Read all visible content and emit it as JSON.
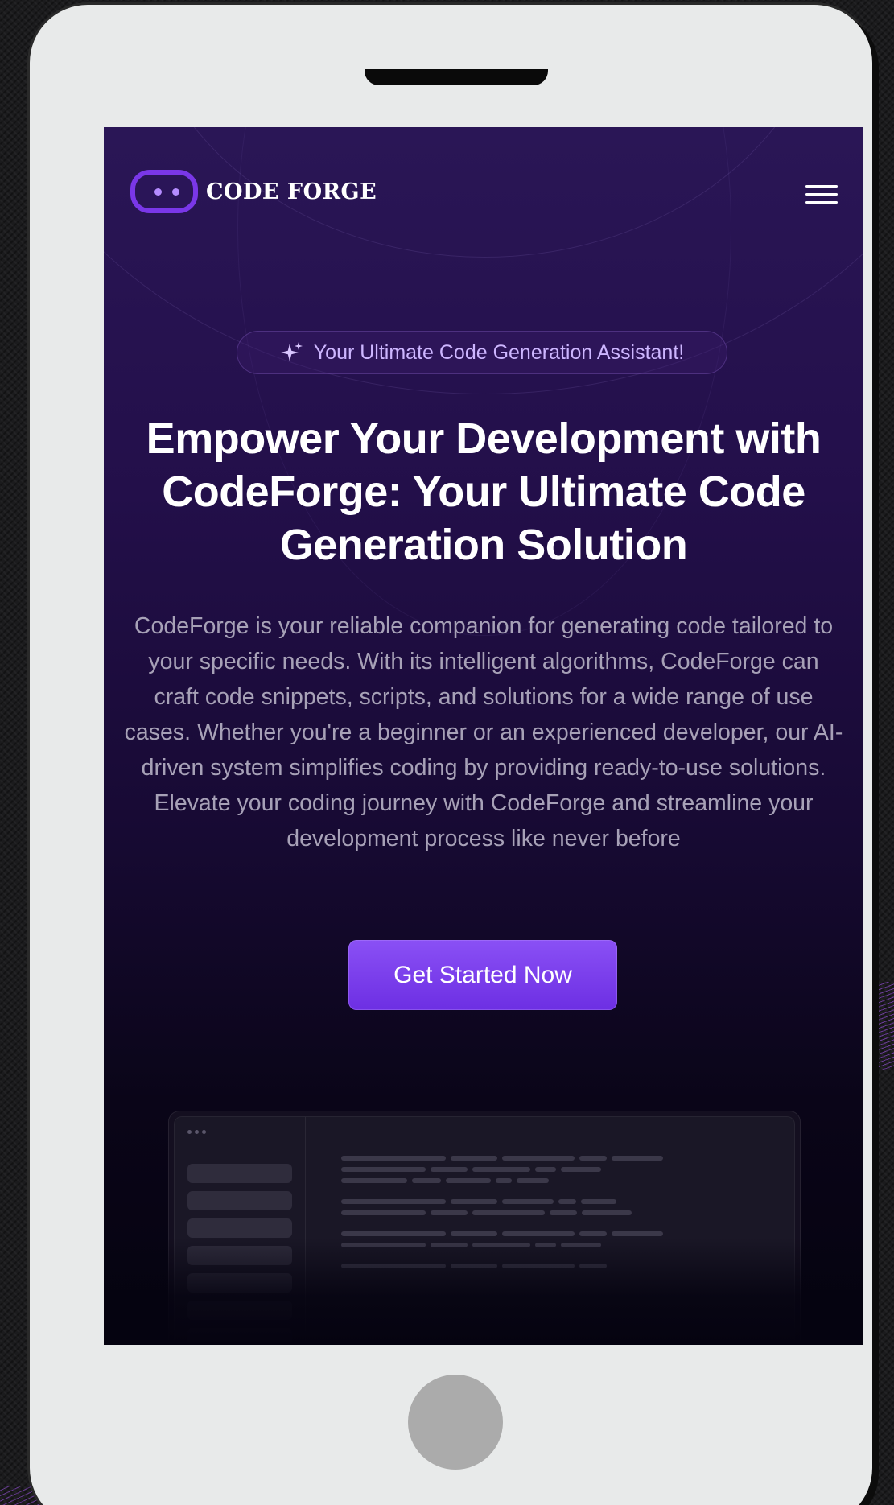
{
  "app": {
    "logo_text": "CODE FORGE",
    "logo_icon": "robot-face-icon",
    "menu_icon": "hamburger-menu-icon"
  },
  "hero": {
    "badge_icon": "sparkle-icon",
    "badge_text": "Your Ultimate Code Generation Assistant!",
    "title": "Empower Your Development with CodeForge: Your Ultimate Code Generation Solution",
    "description": "CodeForge is your reliable companion for generating code tailored to your specific needs. With its intelligent algorithms, CodeForge can craft code snippets, scripts, and solutions for a wide range of use cases. Whether you're a beginner or an experienced developer, our AI-driven system simplifies coding by providing ready-to-use solutions. Elevate your coding journey with CodeForge and streamline your development process like never before",
    "cta_label": "Get Started Now"
  },
  "colors": {
    "brand_purple": "#7a37e8",
    "button_gradient_top": "#8a50f5",
    "button_gradient_bottom": "#6d2fe3",
    "badge_text": "#cdb6ff",
    "background_top": "#2a1656",
    "background_bottom": "#050310",
    "device_frame": "#e8eaea",
    "home_button": "#ababab"
  }
}
